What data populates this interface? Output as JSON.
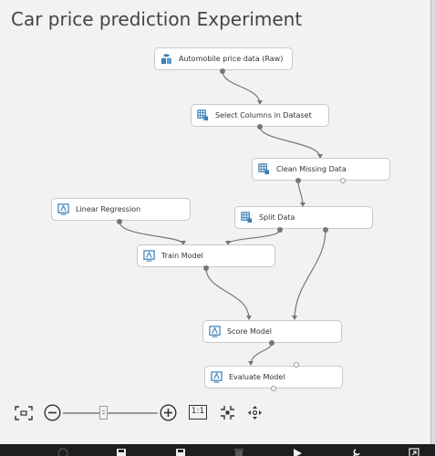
{
  "experiment": {
    "title": "Car price prediction Experiment"
  },
  "modules": [
    {
      "id": "automobile",
      "label": "Automobile price data (Raw)",
      "icon": "dataset-icon"
    },
    {
      "id": "select",
      "label": "Select Columns in Dataset",
      "icon": "table-transform-icon"
    },
    {
      "id": "clean",
      "label": "Clean Missing Data",
      "icon": "table-transform-icon"
    },
    {
      "id": "linreg",
      "label": "Linear Regression",
      "icon": "model-icon"
    },
    {
      "id": "split",
      "label": "Split Data",
      "icon": "table-transform-icon"
    },
    {
      "id": "train",
      "label": "Train Model",
      "icon": "model-icon"
    },
    {
      "id": "score",
      "label": "Score Model",
      "icon": "model-icon"
    },
    {
      "id": "evaluate",
      "label": "Evaluate Model",
      "icon": "model-icon"
    }
  ],
  "zoom_controls": {
    "actual_size_label": "1:1",
    "icons": [
      "fit-to-screen-icon",
      "zoom-out-icon",
      "zoom-slider",
      "zoom-in-icon",
      "actual-size-icon",
      "center-icon",
      "pan-icon"
    ]
  },
  "bottom_toolbar": {
    "icons": [
      "run-history-icon",
      "save-icon",
      "save-as-icon",
      "delete-icon",
      "run-icon",
      "setup-web-service-icon",
      "publish-icon"
    ]
  },
  "colors": {
    "canvas": "#f2f2f2",
    "module_border": "#c8c8c8",
    "wire": "#777777",
    "icon_blue": "#3a7fb5",
    "toolbar": "#1e1e1e"
  }
}
